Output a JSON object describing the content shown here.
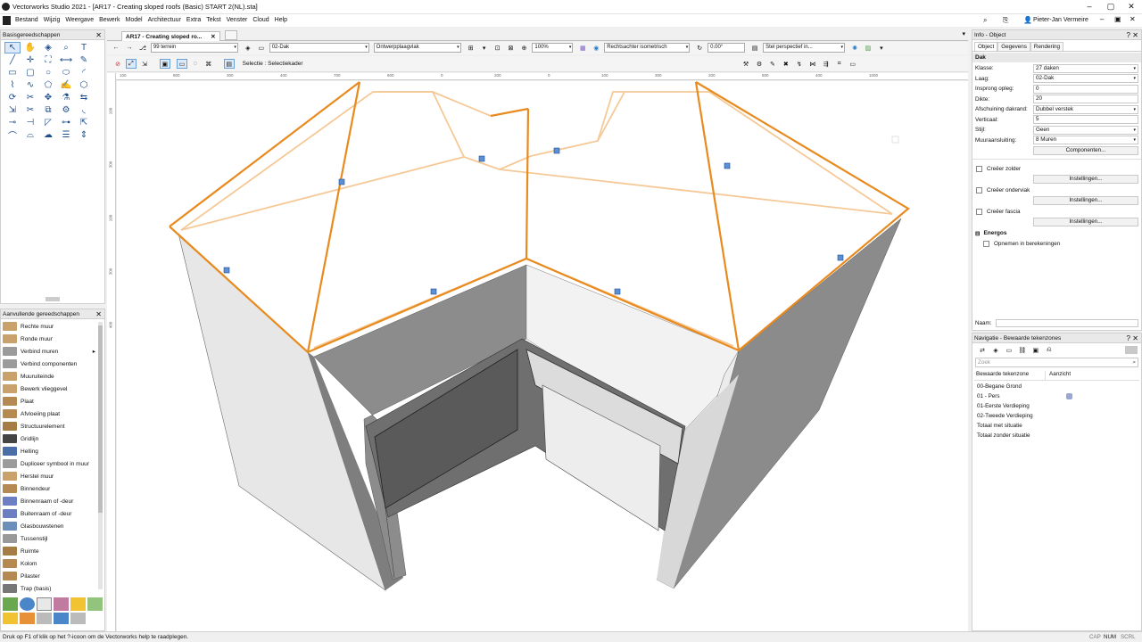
{
  "window": {
    "title": "Vectorworks Studio 2021 - [AR17 -  Creating sloped roofs (Basic) START 2(NL).sta]",
    "user": "Pieter-Jan Vermeire"
  },
  "menu": [
    "Bestand",
    "Wijzig",
    "Weergave",
    "Bewerk",
    "Model",
    "Architectuur",
    "Extra",
    "Tekst",
    "Venster",
    "Cloud",
    "Help"
  ],
  "basic_tools": {
    "title": "Basisgereedschappen",
    "icons": [
      "selection-arrow-icon",
      "pan-hand-icon",
      "flyover-icon",
      "zoom-icon",
      "text-icon",
      "line-icon",
      "crosshair-icon",
      "walkthrough-icon",
      "dimension-icon",
      "pencil-icon",
      "rectangle-icon",
      "rounded-rect-icon",
      "circle-icon",
      "oval-icon",
      "arc-icon",
      "polyline-icon",
      "spline-icon",
      "polygon-icon",
      "freehand-icon",
      "regular-polygon-icon",
      "rotate-icon",
      "clip-icon",
      "move-icon",
      "eyedropper-icon",
      "offset-icon",
      "reshape-icon",
      "split-icon",
      "mirror-icon",
      "attribute-icon",
      "fillet-icon",
      "connect-icon",
      "trim-icon",
      "chamfer-icon",
      "connect-join-icon",
      "stretch-icon",
      "curve-icon",
      "curve2-icon",
      "cloud-icon",
      "stair-icon",
      "scale-icon"
    ]
  },
  "additional_tools": {
    "title": "Aanvullende gereedschappen",
    "items": [
      {
        "label": "Rechte muur",
        "color": "#c9a26b"
      },
      {
        "label": "Ronde muur",
        "color": "#c9a26b"
      },
      {
        "label": "Verbind muren",
        "color": "#9b9b9b",
        "submenu": "▸"
      },
      {
        "label": "Verbind componenten",
        "color": "#9b9b9b"
      },
      {
        "label": "Muuruiteinde",
        "color": "#c9a26b"
      },
      {
        "label": "Bewerk vlieggevel",
        "color": "#c9a26b"
      },
      {
        "label": "Plaat",
        "color": "#b48a52"
      },
      {
        "label": "Afvloeiing plaat",
        "color": "#b48a52"
      },
      {
        "label": "Structuurelement",
        "color": "#a67c45"
      },
      {
        "label": "Gridlijn",
        "color": "#444"
      },
      {
        "label": "Helling",
        "color": "#4a6ea8"
      },
      {
        "label": "Dupliceer symbool in muur",
        "color": "#9b9b9b"
      },
      {
        "label": "Herstel muur",
        "color": "#c9a26b"
      },
      {
        "label": "Binnendeur",
        "color": "#b48a52"
      },
      {
        "label": "Binnenraam of -deur",
        "color": "#6b7fc2"
      },
      {
        "label": "Buitenraam of -deur",
        "color": "#6b7fc2"
      },
      {
        "label": "Glasbouwstenen",
        "color": "#6b8fb8"
      },
      {
        "label": "Tussenstijl",
        "color": "#999"
      },
      {
        "label": "Ruimte",
        "color": "#a67c45"
      },
      {
        "label": "Kolom",
        "color": "#b48a52"
      },
      {
        "label": "Pilaster",
        "color": "#b48a52"
      },
      {
        "label": "Trap (basis)",
        "color": "#777"
      }
    ]
  },
  "document": {
    "tab": "AR17 -  Creating sloped ro...",
    "class": "99 terrein",
    "layer": "02-Dak",
    "plane": "Ontwerpplaagvlak",
    "zoom": "100%",
    "view": "Rechtsachter isometrisch",
    "rotation": "0.00°",
    "render": "Stel perspectief in...",
    "mode": "Selectie : Selectiekader"
  },
  "ruler": {
    "top": [
      "100",
      "800",
      "300",
      "400",
      "700",
      "600",
      "0",
      "200",
      "0",
      "100",
      "300",
      "200",
      "500",
      "400",
      "1000"
    ],
    "left": [
      "100",
      "300",
      "100",
      "300",
      "400"
    ]
  },
  "info": {
    "title": "Info - Object",
    "tabs": [
      "Object",
      "Gegevens",
      "Rendering"
    ],
    "object_type": "Dak",
    "rows": [
      {
        "label": "Klasse:",
        "value": "27 daken",
        "dropdown": "▾"
      },
      {
        "label": "Laag:",
        "value": "02-Dak",
        "dropdown": "▾"
      },
      {
        "label": "Insprong opleg:",
        "value": "0"
      },
      {
        "label": "Dikte:",
        "value": "20"
      },
      {
        "label": "Afschuining dakrand:",
        "value": "Dubbel verstek",
        "dropdown": "▾"
      },
      {
        "label": "Verticaal:",
        "value": "5"
      },
      {
        "label": "Stijl:",
        "value": "Geen",
        "dropdown": "▾"
      },
      {
        "label": "Muuraansluiting:",
        "value": "8 Muren",
        "dropdown": "▾"
      }
    ],
    "components_btn": "Componenten...",
    "checks": [
      {
        "label": "Creëer zolder",
        "btn": "Instellingen..."
      },
      {
        "label": "Creëer onderviak",
        "btn": "Instellingen..."
      },
      {
        "label": "Creëer fascia",
        "btn": "Instellingen..."
      }
    ],
    "energos": {
      "title": "Energos",
      "option": "Opnemen in berekeningen"
    },
    "name_label": "Naam:"
  },
  "navigation": {
    "title": "Navigatie - Bewaarde tekenzones",
    "search_placeholder": "Zoek",
    "col1": "Bewaarde tekenzone",
    "col2": "Aanzicht",
    "items": [
      "00-Begane Grond",
      "01 - Pers",
      "01-Eerste Verdieping",
      "02-Tweede Verdieping",
      "Totaal met situatie",
      "Totaal zonder situatie"
    ]
  },
  "status": {
    "text": "Druk op F1 of klik op het ?-icoon om de Vectorworks help te raadplegen.",
    "cap": "CAP",
    "num": "NUM",
    "scrl": "SCRL"
  },
  "colors": {
    "accent_orange": "#e88a1e",
    "handle_blue": "#3a78c2",
    "wall_light": "#e8e8e8",
    "wall_dark": "#7a7a7a"
  }
}
